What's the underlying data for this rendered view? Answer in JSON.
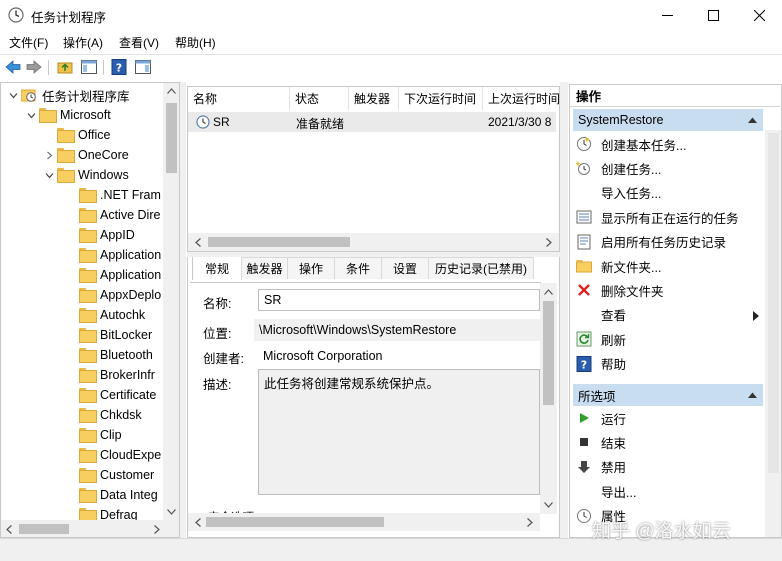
{
  "window": {
    "title": "任务计划程序",
    "icon": "clock-icon"
  },
  "menu": [
    "文件(F)",
    "操作(A)",
    "查看(V)",
    "帮助(H)"
  ],
  "tree": {
    "root": "任务计划程序库",
    "microsoft": "Microsoft",
    "office": "Office",
    "onecore": "OneCore",
    "windows": "Windows",
    "children": [
      ".NET Fram",
      "Active Dire",
      "AppID",
      "Application",
      "Application",
      "AppxDeplo",
      "Autochk",
      "BitLocker",
      "Bluetooth",
      "BrokerInfr",
      "Certificate",
      "Chkdsk",
      "Clip",
      "CloudExpe",
      "Customer",
      "Data Integ",
      "Defrag"
    ]
  },
  "task_list": {
    "columns": [
      "名称",
      "状态",
      "触发器",
      "下次运行时间",
      "上次运行时间"
    ],
    "rows": [
      {
        "name": "SR",
        "status": "准备就绪",
        "trigger": "",
        "next_run": "",
        "last_run": "2021/3/30 8"
      }
    ]
  },
  "tabs": [
    "常规",
    "触发器",
    "操作",
    "条件",
    "设置",
    "历史记录(已禁用)"
  ],
  "general": {
    "name_label": "名称:",
    "name_value": "SR",
    "location_label": "位置:",
    "location_value": "\\Microsoft\\Windows\\SystemRestore",
    "author_label": "创建者:",
    "author_value": "Microsoft Corporation",
    "desc_label": "描述:",
    "desc_value": "此任务将创建常规系统保护点。",
    "security_label": "安全选项"
  },
  "actions": {
    "header": "操作",
    "section1": "SystemRestore",
    "items1": [
      {
        "label": "创建基本任务...",
        "icon": "create-basic-task-icon"
      },
      {
        "label": "创建任务...",
        "icon": "create-task-icon"
      },
      {
        "label": "导入任务...",
        "icon": ""
      },
      {
        "label": "显示所有正在运行的任务",
        "icon": "running-tasks-icon"
      },
      {
        "label": "启用所有任务历史记录",
        "icon": "history-icon"
      },
      {
        "label": "新文件夹...",
        "icon": "new-folder-icon"
      },
      {
        "label": "删除文件夹",
        "icon": "delete-icon"
      },
      {
        "label": "查看",
        "icon": ""
      },
      {
        "label": "刷新",
        "icon": "refresh-icon"
      },
      {
        "label": "帮助",
        "icon": "help-icon"
      }
    ],
    "section2": "所选项",
    "items2": [
      {
        "label": "运行",
        "icon": "run-icon"
      },
      {
        "label": "结束",
        "icon": "stop-icon"
      },
      {
        "label": "禁用",
        "icon": "disable-icon"
      },
      {
        "label": "导出...",
        "icon": ""
      },
      {
        "label": "属性",
        "icon": "properties-icon"
      }
    ]
  },
  "watermark": "知乎 @洛水如云",
  "colors": {
    "section_bg": "#c9ddf1",
    "selected_row": "#eaeaea"
  }
}
